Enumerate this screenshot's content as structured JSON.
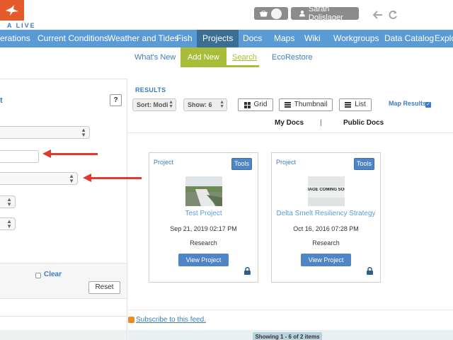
{
  "brand": {
    "logo_text": "A LIVE",
    "accent": "#5b9bd5",
    "logo_color": "#e45a2b"
  },
  "header": {
    "user_name": "Sarah Dolislager"
  },
  "main_nav": [
    {
      "label": "erations"
    },
    {
      "label": "Current Conditions"
    },
    {
      "label": "Weather and Tides"
    },
    {
      "label": "Fish"
    },
    {
      "label": "Projects",
      "active": true
    },
    {
      "label": "Docs"
    },
    {
      "label": "Maps"
    },
    {
      "label": "Wiki"
    },
    {
      "label": "Workgroups"
    },
    {
      "label": "Data Catalog"
    },
    {
      "label": "Explor"
    }
  ],
  "sub_nav": [
    {
      "label": "What's New"
    },
    {
      "label": "Add New"
    },
    {
      "label": "Search",
      "active": true
    },
    {
      "label": "EcoRestore"
    }
  ],
  "left_panel": {
    "title_fragment": "t",
    "help_label": "?",
    "clear_label": "Clear",
    "reset_label": "Reset"
  },
  "results": {
    "heading": "RESULTS",
    "sort_label": "Sort: Modi",
    "show_label": "Show: 6",
    "view_buttons": {
      "grid": "Grid",
      "thumbnail": "Thumbnail",
      "list": "List"
    },
    "map_results_label": "Map Results",
    "map_results_checked": true,
    "tabs": {
      "my_docs": "My Docs",
      "separator": "|",
      "public_docs": "Public Docs"
    },
    "cards": [
      {
        "type": "Project",
        "tools": "Tools",
        "title": "Test Project",
        "date": "Sep 21, 2019 02:17 PM",
        "category": "Research",
        "button": "View Project",
        "thumb_kind": "photo"
      },
      {
        "type": "Project",
        "tools": "Tools",
        "title": "Delta Smelt Resiliency Strategy",
        "date": "Oct 16, 2016 07:28 PM",
        "category": "Research",
        "button": "View Project",
        "thumb_kind": "placeholder",
        "thumb_text": "IAGE COMING SOC"
      }
    ],
    "subscribe_label": "Subscribe to this feed.",
    "pager_text": "Showing 1 - 6 of 2 items"
  }
}
